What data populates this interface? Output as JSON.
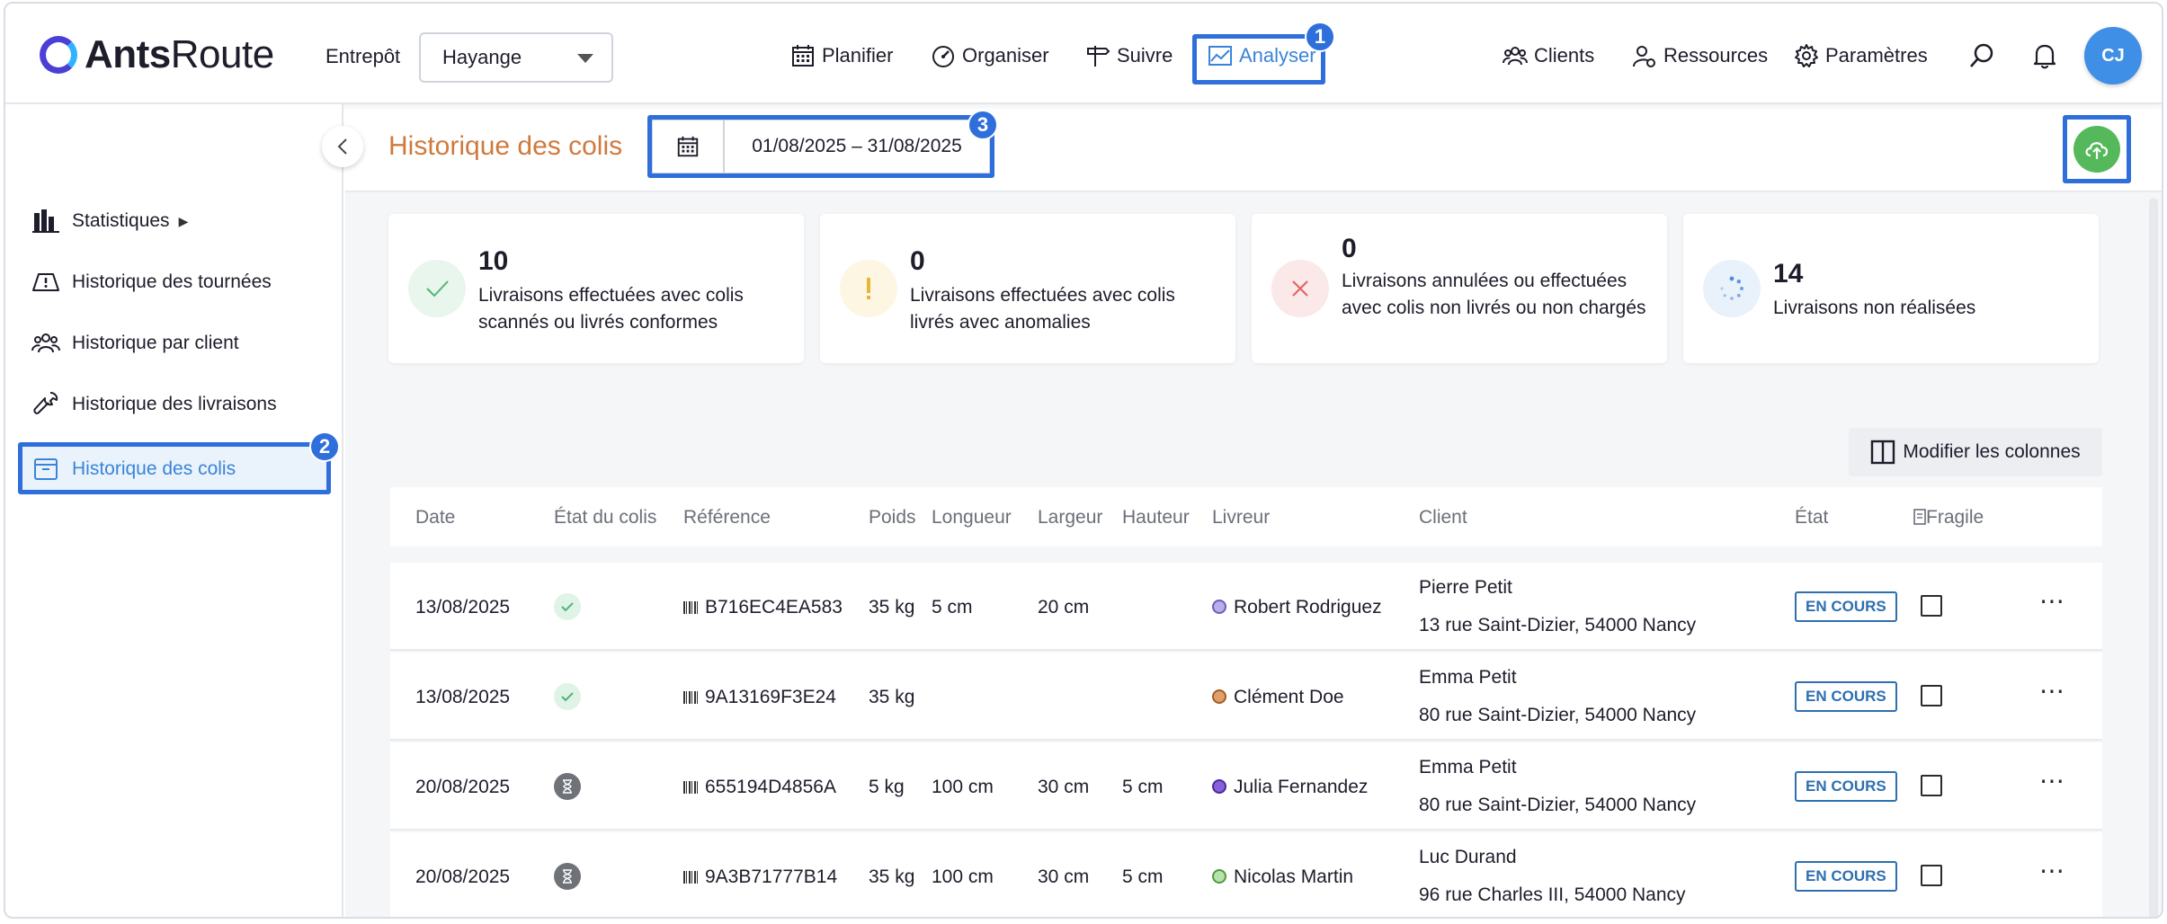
{
  "header": {
    "logo_bold": "Ants",
    "logo_light": "Route",
    "entrepot_label": "Entrepôt",
    "entrepot_value": "Hayange",
    "nav": [
      {
        "label": "Planifier",
        "icon": "calendar-icon"
      },
      {
        "label": "Organiser",
        "icon": "gauge-icon"
      },
      {
        "label": "Suivre",
        "icon": "signpost-icon"
      },
      {
        "label": "Analyser",
        "icon": "chart-icon",
        "active": true
      }
    ],
    "right_nav": [
      {
        "label": "Clients",
        "icon": "users-icon"
      },
      {
        "label": "Ressources",
        "icon": "user-gear-icon"
      },
      {
        "label": "Paramètres",
        "icon": "gear-icon"
      }
    ],
    "avatar_initials": "CJ"
  },
  "annotations": [
    "1",
    "2",
    "3"
  ],
  "sidebar": {
    "items": [
      {
        "label": "Statistiques",
        "icon": "bar-chart-icon",
        "has_submenu": true
      },
      {
        "label": "Historique des tournées",
        "icon": "map-icon"
      },
      {
        "label": "Historique par client",
        "icon": "users-icon"
      },
      {
        "label": "Historique des livraisons",
        "icon": "wrench-icon"
      },
      {
        "label": "Historique des colis",
        "icon": "box-icon",
        "active": true
      }
    ],
    "submenu_marker": "▶"
  },
  "page": {
    "title": "Historique des colis",
    "date_range": "01/08/2025 – 31/08/2025"
  },
  "stats": [
    {
      "value": "10",
      "description": "Livraisons effectuées avec colis scannés ou livrés conformes",
      "icon": "check-icon",
      "color": "#4fb477"
    },
    {
      "value": "0",
      "description": "Livraisons effectuées avec colis livrés avec anomalies",
      "icon": "exclamation-icon",
      "color": "#e7b53a"
    },
    {
      "value": "0",
      "description": "Livraisons annulées ou effectuées avec colis non livrés ou non chargés",
      "icon": "cross-icon",
      "color": "#e06666"
    },
    {
      "value": "14",
      "description": "Livraisons non réalisées",
      "icon": "spinner-icon",
      "color": "#4a8fd8"
    }
  ],
  "table": {
    "modify_columns_label": "Modifier les colonnes",
    "headers": {
      "date": "Date",
      "state": "État du colis",
      "reference": "Référence",
      "weight": "Poids",
      "length": "Longueur",
      "width": "Largeur",
      "height": "Hauteur",
      "driver": "Livreur",
      "client": "Client",
      "status": "État",
      "fragile": "Fragile"
    },
    "rows": [
      {
        "date": "13/08/2025",
        "state": "delivered",
        "reference": "B716EC4EA583",
        "weight": "35 kg",
        "length": "5 cm",
        "width": "20 cm",
        "height": "",
        "driver": "Robert Rodriguez",
        "driver_color": "#8c7ad6",
        "client_name": "Pierre Petit",
        "client_address": "13 rue Saint-Dizier, 54000 Nancy",
        "status": "EN COURS"
      },
      {
        "date": "13/08/2025",
        "state": "delivered",
        "reference": "9A13169F3E24",
        "weight": "35 kg",
        "length": "",
        "width": "",
        "height": "",
        "driver": "Clément Doe",
        "driver_color": "#c77a3a",
        "client_name": "Emma Petit",
        "client_address": "80 rue Saint-Dizier, 54000 Nancy",
        "status": "EN COURS"
      },
      {
        "date": "20/08/2025",
        "state": "pending",
        "reference": "655194D4856A",
        "weight": "5 kg",
        "length": "100 cm",
        "width": "30 cm",
        "height": "5 cm",
        "driver": "Julia Fernandez",
        "driver_color": "#6a3fc7",
        "client_name": "Emma Petit",
        "client_address": "80 rue Saint-Dizier, 54000 Nancy",
        "status": "EN COURS"
      },
      {
        "date": "20/08/2025",
        "state": "pending",
        "reference": "9A3B71777B14",
        "weight": "35 kg",
        "length": "100 cm",
        "width": "30 cm",
        "height": "5 cm",
        "driver": "Nicolas Martin",
        "driver_color": "#7ac26b",
        "client_name": "Luc Durand",
        "client_address": "96 rue Charles III, 54000 Nancy",
        "status": "EN COURS"
      }
    ]
  }
}
